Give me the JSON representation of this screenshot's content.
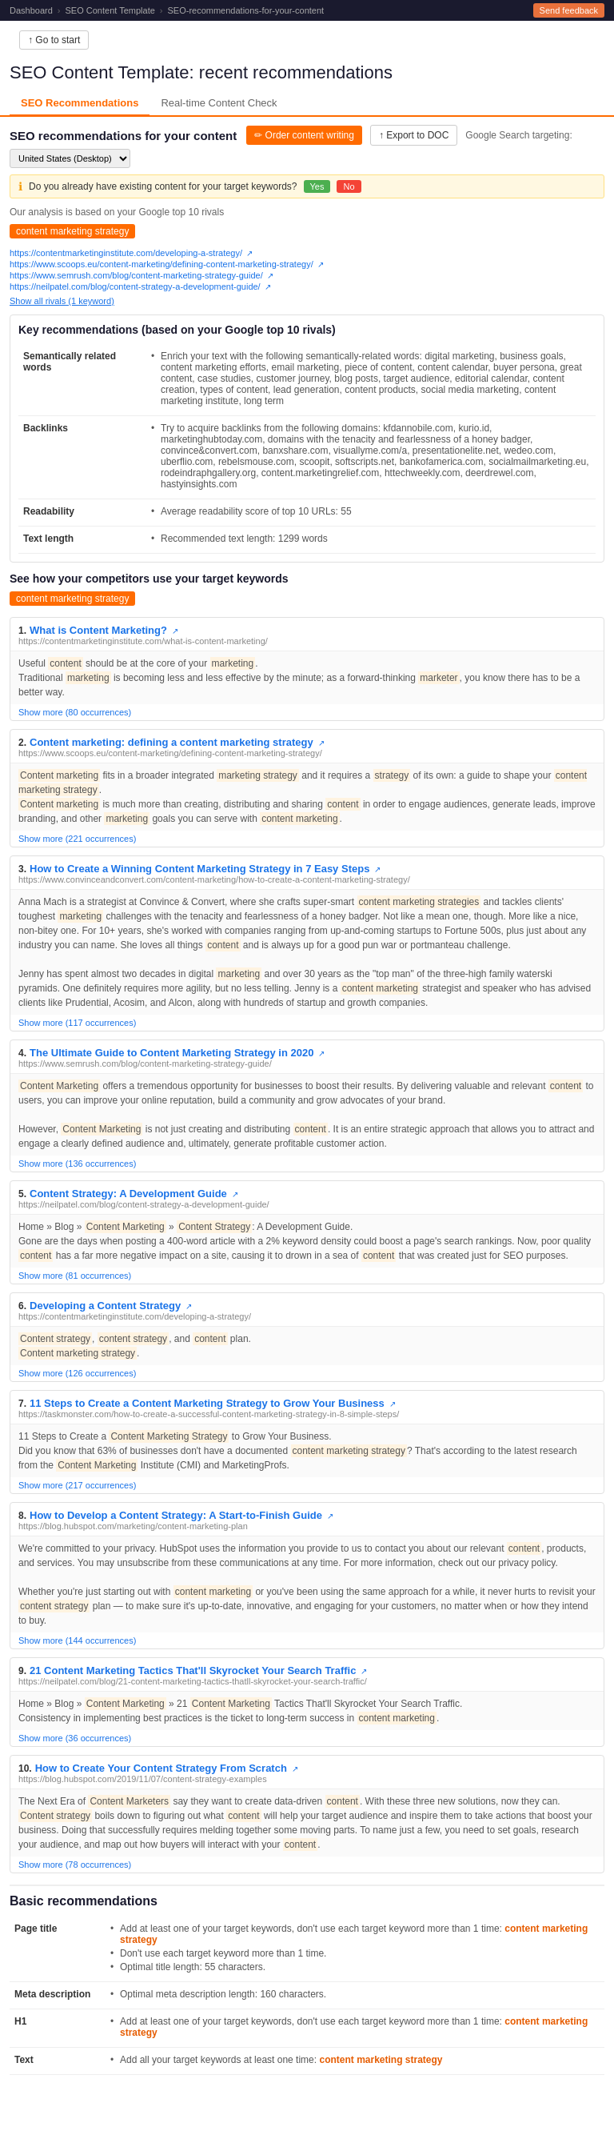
{
  "topbar": {
    "breadcrumb": [
      "Dashboard",
      "SEO Content Template",
      "SEO-recommendations-for-your-content"
    ],
    "feedback_label": "Send feedback"
  },
  "go_to_start": "↑ Go to start",
  "page_title_prefix": "SEO Content Template:",
  "page_title_suffix": " recent recommendations",
  "tabs": [
    {
      "label": "SEO Recommendations",
      "active": true
    },
    {
      "label": "Real-time Content Check",
      "active": false
    }
  ],
  "seo_rec_title": "SEO recommendations for your content",
  "order_content_btn": "✏ Order content writing",
  "export_btn": "↑ Export to DOC",
  "google_targeting_label": "Google Search targeting:",
  "google_targeting_value": "United States (Desktop)",
  "info_box_text": "Do you already have existing content for your target keywords?",
  "yes_label": "Yes",
  "no_label": "No",
  "analysis_note": "Our analysis is based on your Google top 10 rivals",
  "keyword_tag": "content marketing strategy",
  "rival_urls": [
    "https://contentmarketinginstitute.com/developing-a-strategy/",
    "https://www.scoops.eu/content-marketing/defining-content-marketing-strategy/",
    "https://www.semrush.com/blog/content-marketing-strategy-guide/",
    "https://neilpatel.com/blog/content-strategy-a-development-guide/"
  ],
  "show_rivals": "Show all rivals (1 keyword)",
  "key_rec_section": "Key recommendations (based on your Google top 10 rivals)",
  "semantically_related_label": "Semantically related words",
  "semantically_related_text": "Enrich your text with the following semantically-related words: digital marketing, business goals, content marketing efforts, email marketing, piece of content, content calendar, buyer persona, great content, case studies, customer journey, blog posts, target audience, editorial calendar, content creation, types of content, lead generation, content products, social media marketing, content marketing institute, long term",
  "backlinks_label": "Backlinks",
  "backlinks_text": "Try to acquire backlinks from the following domains: kfdannobile.com, kurio.id, marketinghubtoday.com, domains with the tenacity and fearlessness of a honey badger, convince&convert.com, banxshare.com, visuallyme.com/a, presentationelite.net, wedeo.com, uberflio.com, rebelsmouse.com, scoopit, softscripts.net, bankofamerica.com, socialmailmarketing.eu, rodeindraphgallery.org, content.marketingrelief.com, httechweekly.com, deerdrewel.com, hastyinsights.com",
  "readability_label": "Readability",
  "readability_text": "Average readability score of top 10 URLs: 55",
  "text_length_label": "Text length",
  "text_length_text": "Recommended text length: 1299 words",
  "see_competitors_title": "See how your competitors use your target keywords",
  "competitor_keyword_tag": "content marketing strategy",
  "results": [
    {
      "num": "1.",
      "title": "What is Content Marketing?",
      "url": "https://contentmarketinginstitute.com/what-is-content-marketing/",
      "excerpt": "Useful content should be at the core of your marketing.\nTraditional marketing is becoming less and less effective by the minute; as a forward-thinking marketer, you know there has to be a better way.",
      "show_more": "Show more (80 occurrences)"
    },
    {
      "num": "2.",
      "title": "Content marketing: defining a content marketing strategy",
      "url": "https://www.scoops.eu/content-marketing/defining-content-marketing-strategy/",
      "excerpt": "Content marketing fits in a broader integrated marketing strategy and it requires a strategy of its own: a guide to shape your content marketing strategy.\nContent marketing is much more than creating, distributing and sharing content in order to engage audiences, generate leads, improve branding, and other marketing goals you can serve with content marketing.",
      "show_more": "Show more (221 occurrences)"
    },
    {
      "num": "3.",
      "title": "How to Create a Winning Content Marketing Strategy in 7 Easy Steps",
      "url": "https://www.convinceandconvert.com/content-marketing/how-to-create-a-content-marketing-strategy/",
      "excerpt": "Anna Mach is a strategist at Convince & Convert, where she crafts super-smart content marketing strategies and tackles clients' toughest marketing challenges with the tenacity and fearlessness of a honey badger. Not like a mean one, though. More like a nice, non-bitey one. For 10+ years, she's worked with companies ranging from up-and-coming startups to Fortune 500s, plus just about any industry you can name. She loves all things content and is always up for a good pun war or portmanteau challenge.\nJenny has spent almost two decades in digital marketing and over 30 years as the \"top man\" of the three-high family waterski pyramids. One definitely requires more agility, but no less telling. Jenny is a content marketing strategist and speaker who has advised clients like Prudential, Acosim, and Alcon, along with hundreds of startup and growth companies.",
      "show_more": "Show more (117 occurrences)"
    },
    {
      "num": "4.",
      "title": "The Ultimate Guide to Content Marketing Strategy in 2020",
      "url": "https://www.semrush.com/blog/content-marketing-strategy-guide/",
      "excerpt": "Content Marketing offers a tremendous opportunity for businesses to boost their results. By delivering valuable and relevant content to users, you can improve your online reputation, build a community and grow advocates of your brand.\nHowever, Content Marketing is not just creating and distributing content. It is an entire strategic approach that allows you to attract and engage a clearly defined audience and, ultimately, generate profitable customer action.",
      "show_more": "Show more (136 occurrences)"
    },
    {
      "num": "5.",
      "title": "Content Strategy: A Development Guide",
      "url": "https://neilpatel.com/blog/content-strategy-a-development-guide/",
      "excerpt": "Home » Blog » Content Marketing » Content Strategy: A Development Guide.\nGone are the days when posting a 400-word article with a 2% keyword density could boost a page's search rankings. Now, poor quality content has a far more negative impact on a site, causing it to drown in a sea of content that was created just for SEO purposes.",
      "show_more": "Show more (81 occurrences)"
    },
    {
      "num": "6.",
      "title": "Developing a Content Strategy",
      "url": "https://contentmarketinginstitute.com/developing-a-strategy/",
      "excerpt": "Content strategy, content strategy, and content plan.\nContent marketing strategy.",
      "show_more": "Show more (126 occurrences)"
    },
    {
      "num": "7.",
      "title": "11 Steps to Create a Content Marketing Strategy to Grow Your Business",
      "url": "https://taskmonster.com/how-to-create-a-successful-content-marketing-strategy-in-8-simple-steps/",
      "excerpt": "11 Steps to Create a Content Marketing Strategy to Grow Your Business.\nDid you know that 63% of businesses don't have a documented content marketing strategy? That's according to the latest research from the Content Marketing Institute (CMI) and MarketingProfs.",
      "show_more": "Show more (217 occurrences)"
    },
    {
      "num": "8.",
      "title": "How to Develop a Content Strategy: A Start-to-Finish Guide",
      "url": "https://blog.hubspot.com/marketing/content-marketing-plan",
      "excerpt": "We're committed to your privacy. HubSpot uses the information you provide to us to contact you about our relevant content, products, and services. You may unsubscribe from these communications at any time. For more information, check out our privacy policy.\nWhether you're just starting out with content marketing or you've been using the same approach for a while, it never hurts to revisit your content strategy plan — to make sure it's up-to-date, innovative, and engaging for your customers, no matter when or how they intend to buy.",
      "show_more": "Show more (144 occurrences)"
    },
    {
      "num": "9.",
      "title": "21 Content Marketing Tactics That'll Skyrocket Your Search Traffic",
      "url": "https://neilpatel.com/blog/21-content-marketing-tactics-thatll-skyrocket-your-search-traffic/",
      "excerpt": "Home » Blog » Content Marketing » 21 Content Marketing Tactics That'll Skyrocket Your Search Traffic.\nConsistency in implementing best practices is the ticket to long-term success in content marketing.",
      "show_more": "Show more (36 occurrences)"
    },
    {
      "num": "10.",
      "title": "How to Create Your Content Strategy From Scratch",
      "url": "https://blog.hubspot.com/2019/11/07/content-strategy-examples",
      "excerpt": "The Next Era of Content Marketers say they want to create data-driven content. With these three new solutions, now they can.\nContent strategy boils down to figuring out what content will help your target audience and inspire them to take actions that boost your business. Doing that successfully requires melding together some moving parts. To name just a few, you need to set goals, research your audience, and map out how buyers will interact with your content.",
      "show_more": "Show more (78 occurrences)"
    }
  ],
  "basic_rec_title": "Basic recommendations",
  "basic_recs": [
    {
      "label": "Page title",
      "items": [
        "Add at least one of your target keywords, don't use each target keyword more than 1 time:  content marketing strategy",
        "Don't use each target keyword more than 1 time.",
        "Optimal title length: 55 characters."
      ]
    },
    {
      "label": "Meta description",
      "items": [
        "Optimal meta description length: 160 characters."
      ]
    },
    {
      "label": "H1",
      "items": [
        "Add at least one of your target keywords, don't use each target keyword more than 1 time:  content marketing strategy"
      ]
    },
    {
      "label": "Text",
      "items": [
        "Add all your target keywords at least one time:  content marketing strategy"
      ]
    }
  ]
}
